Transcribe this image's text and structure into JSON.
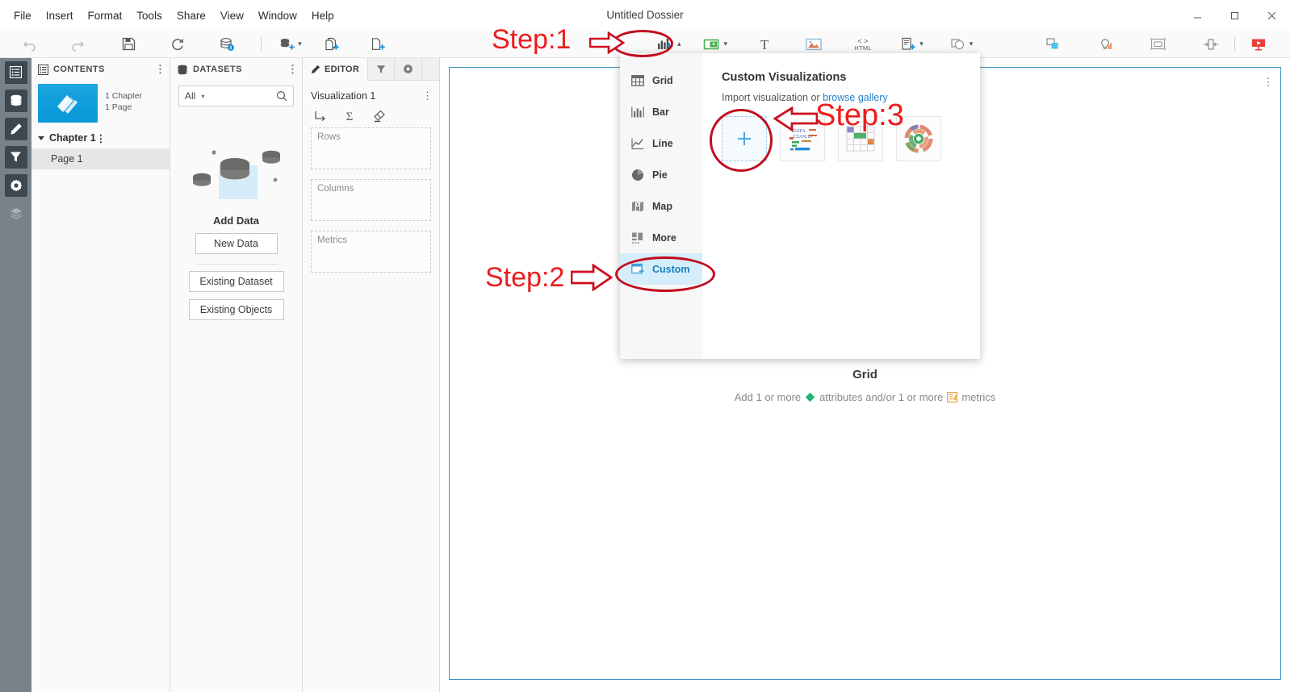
{
  "window": {
    "title": "Untitled Dossier",
    "controls": {
      "minimize": "minimize-icon",
      "maximize": "maximize-icon",
      "close": "close-icon"
    }
  },
  "menubar": {
    "items": [
      {
        "label": "File"
      },
      {
        "label": "Insert"
      },
      {
        "label": "Format"
      },
      {
        "label": "Tools"
      },
      {
        "label": "Share"
      },
      {
        "label": "View"
      },
      {
        "label": "Window"
      },
      {
        "label": "Help"
      }
    ]
  },
  "toolbar": {
    "left_items": [
      {
        "name": "undo-icon",
        "title": "Undo"
      },
      {
        "name": "redo-icon",
        "title": "Redo"
      },
      {
        "name": "save-icon",
        "title": "Save"
      },
      {
        "name": "refresh-icon",
        "title": "Refresh"
      },
      {
        "name": "data-info-icon",
        "title": "Dataset Information"
      }
    ],
    "mid_items": [
      {
        "name": "add-data-icon",
        "title": "Add Data",
        "caret": true
      },
      {
        "name": "add-chapter-icon",
        "title": "Insert Chapter"
      },
      {
        "name": "add-page-icon",
        "title": "Insert Page"
      }
    ],
    "insert_items": [
      {
        "name": "insert-visualization-icon",
        "title": "Insert Visualization",
        "caret": true
      },
      {
        "name": "insert-filter-icon",
        "title": "Insert Filter",
        "caret": true
      },
      {
        "name": "insert-text-icon",
        "title": "Insert Text"
      },
      {
        "name": "insert-image-icon",
        "title": "Insert Image"
      },
      {
        "name": "insert-html-icon",
        "title": "HTML",
        "label": "HTML"
      },
      {
        "name": "insert-info-window-icon",
        "title": "Insert Information Window",
        "caret": true
      },
      {
        "name": "insert-shape-icon",
        "title": "Insert Shape",
        "caret": true
      }
    ],
    "right_items": [
      {
        "name": "duplicate-icon",
        "title": "Copy Format"
      },
      {
        "name": "insights-icon",
        "title": "Insights"
      },
      {
        "name": "layout-icon",
        "title": "Layout"
      },
      {
        "name": "panel-toggle-icon",
        "title": "Toggle Panel"
      },
      {
        "name": "present-icon",
        "title": "Presentation Mode"
      }
    ]
  },
  "rail": {
    "items": [
      {
        "name": "sidebar-item-table-of-contents",
        "icon": "list-icon",
        "active": true
      },
      {
        "name": "sidebar-item-datasets",
        "icon": "database-icon",
        "active": true
      },
      {
        "name": "sidebar-item-editor",
        "icon": "pencil-icon",
        "active": true
      },
      {
        "name": "sidebar-item-filters",
        "icon": "funnel-icon",
        "active": true
      },
      {
        "name": "sidebar-item-properties",
        "icon": "gear-icon",
        "active": true
      },
      {
        "name": "sidebar-item-layers",
        "icon": "layers-icon",
        "active": false
      }
    ]
  },
  "contents": {
    "header": "CONTENTS",
    "doc_meta_line1": "1 Chapter",
    "doc_meta_line2": "1 Page",
    "chapter": "Chapter 1",
    "page": "Page 1"
  },
  "datasets": {
    "header": "DATASETS",
    "filter_value": "All",
    "search_placeholder": "",
    "empty_title": "Add Data",
    "buttons": [
      "New Data",
      "Existing Dataset",
      "Existing Objects"
    ]
  },
  "editor": {
    "tabs": [
      {
        "label": "EDITOR",
        "icon": "pencil-icon",
        "active": true
      },
      {
        "label": "",
        "icon": "funnel-icon",
        "active": false
      },
      {
        "label": "",
        "icon": "gear-icon",
        "active": false
      }
    ],
    "visualization_name": "Visualization 1",
    "tool_icons": [
      "pivot-icon",
      "sigma-icon",
      "eraser-icon"
    ],
    "zones": [
      {
        "label": "Rows"
      },
      {
        "label": "Columns"
      },
      {
        "label": "Metrics"
      }
    ]
  },
  "canvas": {
    "placeholder_title": "Grid",
    "hint_prefix": "Add 1 or more",
    "hint_attributes": "attributes and/or 1 or more",
    "hint_metrics": "metrics",
    "attribute_icon": "attribute-diamond-icon",
    "metric_icon": "metric-icon"
  },
  "viz_menu": {
    "items": [
      {
        "label": "Grid",
        "icon": "grid-icon",
        "active": false
      },
      {
        "label": "Bar",
        "icon": "bar-chart-icon",
        "active": false
      },
      {
        "label": "Line",
        "icon": "line-chart-icon",
        "active": false
      },
      {
        "label": "Pie",
        "icon": "pie-chart-icon",
        "active": false
      },
      {
        "label": "Map",
        "icon": "map-icon",
        "active": false
      },
      {
        "label": "More",
        "icon": "more-icon",
        "active": false
      },
      {
        "label": "Custom",
        "icon": "custom-viz-icon",
        "active": true
      }
    ],
    "heading": "Custom Visualizations",
    "subtext_prefix": "Import visualization or",
    "subtext_link": "browse gallery",
    "cards": [
      {
        "name": "add-custom-visualization-card",
        "label": "+"
      },
      {
        "name": "data-cloud-visualization-card",
        "label": "DATA CLOUD"
      },
      {
        "name": "gantt-visualization-card",
        "label": ""
      },
      {
        "name": "sunburst-visualization-card",
        "label": ""
      }
    ]
  },
  "annotations": {
    "step1": "Step:1",
    "step2": "Step:2",
    "step3": "Step:3",
    "color": "#ee1c1c",
    "ellipse_color": "#c00d1e"
  }
}
